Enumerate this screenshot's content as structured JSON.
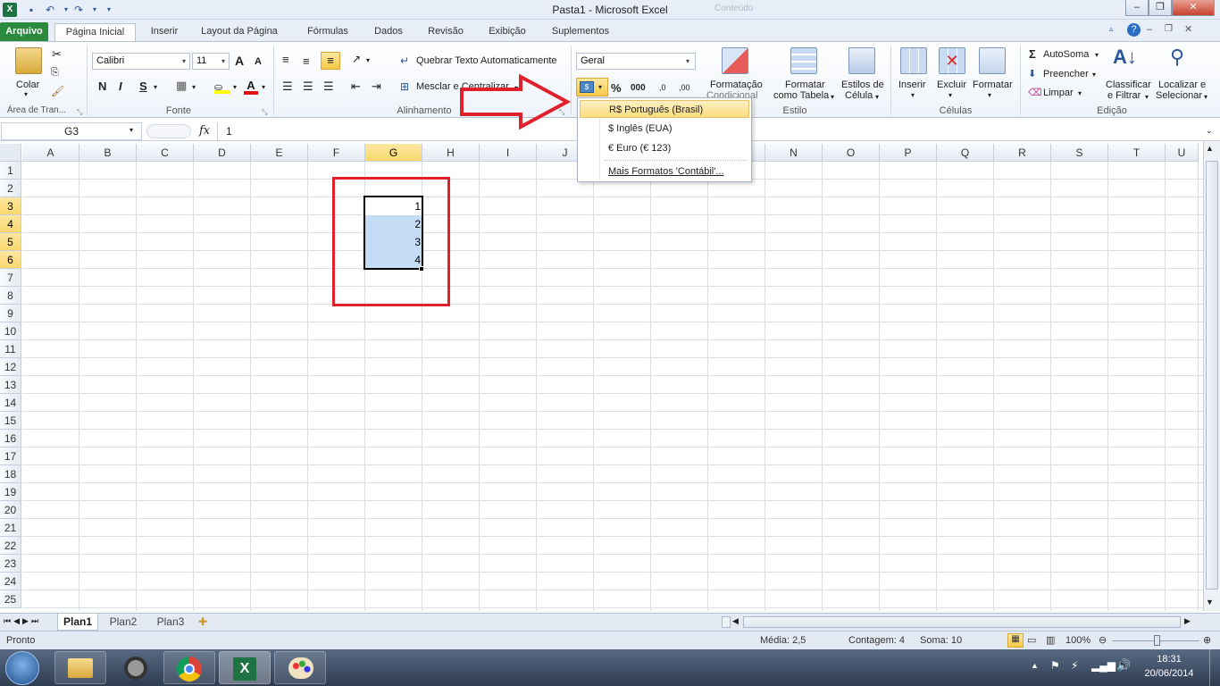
{
  "window": {
    "title": "Pasta1  -  Microsoft Excel",
    "inactive_tab": "Conteúdo"
  },
  "tabs": [
    "Arquivo",
    "Página Inicial",
    "Inserir",
    "Layout da Página",
    "Fórmulas",
    "Dados",
    "Revisão",
    "Exibição",
    "Suplementos"
  ],
  "ribbon": {
    "clipboard": {
      "paste": "Colar",
      "group": "Área de Tran..."
    },
    "font": {
      "name": "Calibri",
      "size": "11",
      "bold": "N",
      "italic": "I",
      "underline": "S",
      "grow": "A",
      "shrink": "A",
      "group": "Fonte"
    },
    "alignment": {
      "wrap": "Quebrar Texto Automaticamente",
      "merge": "Mesclar e Centralizar",
      "group": "Alinhamento"
    },
    "number": {
      "format": "Geral",
      "percent": "%",
      "thousands": "000",
      "dec_inc": ",0",
      "dec_dec": ",00"
    },
    "styles": {
      "cond_fmt": "Formatação",
      "cond_fmt2": "Condicional",
      "as_table": "Formatar",
      "as_table2": "como Tabela",
      "cell_styles": "Estilos de",
      "cell_styles2": "Célula",
      "group": "Estilo"
    },
    "cells": {
      "insert": "Inserir",
      "delete": "Excluir",
      "format": "Formatar",
      "group": "Células"
    },
    "editing": {
      "autosum": "AutoSoma",
      "fill": "Preencher",
      "clear": "Limpar",
      "sort": "Classificar",
      "sort2": "e Filtrar",
      "find": "Localizar e",
      "find2": "Selecionar",
      "group": "Edição"
    }
  },
  "formula_bar": {
    "name_box": "G3",
    "fx": "fx",
    "value": "1"
  },
  "columns": [
    "A",
    "B",
    "C",
    "D",
    "E",
    "F",
    "G",
    "H",
    "I",
    "J",
    "K",
    "L",
    "M",
    "N",
    "O",
    "P",
    "Q",
    "R",
    "S",
    "T",
    "U"
  ],
  "rows": [
    "1",
    "2",
    "3",
    "4",
    "5",
    "6",
    "7",
    "8",
    "9",
    "10",
    "11",
    "12",
    "13",
    "14",
    "15",
    "16",
    "17",
    "18",
    "19",
    "20",
    "21",
    "22",
    "23",
    "24",
    "25"
  ],
  "cells": {
    "G3": "1",
    "G4": "2",
    "G5": "3",
    "G6": "4"
  },
  "currency_menu": {
    "items": [
      "R$ Português (Brasil)",
      "$ Inglês (EUA)",
      "€ Euro (€ 123)"
    ],
    "more": "Mais Formatos 'Contábil'..."
  },
  "sheets": [
    "Plan1",
    "Plan2",
    "Plan3"
  ],
  "status": {
    "mode": "Pronto",
    "average": "Média: 2,5",
    "count": "Contagem: 4",
    "sum": "Soma: 10",
    "zoom": "100%"
  },
  "clock": {
    "time": "18:31",
    "date": "20/06/2014"
  },
  "colors": {
    "file_tab": "#2a8a3e",
    "selection": "#c5dcf7",
    "annotation": "#e0202a",
    "header_highlight": "#f9d86c"
  }
}
